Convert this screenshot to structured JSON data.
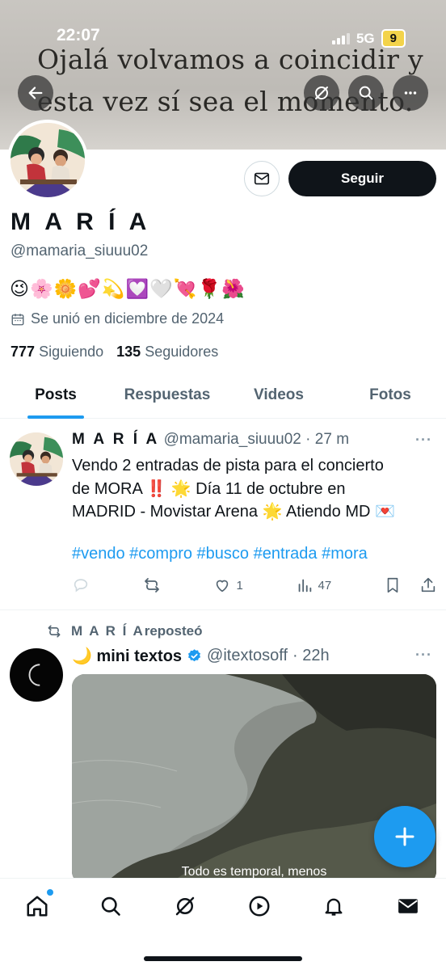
{
  "status_bar": {
    "time": "22:07",
    "network": "5G",
    "battery": "9"
  },
  "banner": {
    "line1": "Ojalá volvamos a coincidir y",
    "line2": "esta vez sí sea el momento."
  },
  "profile": {
    "name": "M A R Í A",
    "handle": "@mamaria_siuuu02",
    "bio": "😉🌸🌼💕💫💟🤍💘🌹🌺",
    "joined": "Se unió en diciembre de 2024",
    "following_count": "777",
    "following_label": "Siguiendo",
    "followers_count": "135",
    "followers_label": "Seguidores",
    "follow_button": "Seguir"
  },
  "tabs": [
    {
      "label": "Posts",
      "active": true
    },
    {
      "label": "Respuestas",
      "active": false
    },
    {
      "label": "Videos",
      "active": false
    },
    {
      "label": "Fotos",
      "active": false
    }
  ],
  "post1": {
    "author": "M A R Í A",
    "handle": "@mamaria_siuuu02",
    "time": "· 27 m",
    "line1": "Vendo 2 entradas de pista para el concierto",
    "line2": "de MORA ‼️ 🌟 Día 11 de octubre en",
    "line3": "MADRID - Movistar Arena 🌟 Atiendo MD 💌",
    "hashtags": "#vendo #compro #busco #entrada #mora",
    "likes": "1",
    "views": "47"
  },
  "post2": {
    "repost_author": "M A R Í A",
    "repost_label": "reposteó",
    "author": "🌙 mini textos",
    "handle": "@itextosoff",
    "time": "· 22h",
    "media_caption": "Todo es temporal, menos"
  },
  "icons": {
    "back": "arrow-left-icon",
    "grok": "grok-icon",
    "search": "search-icon",
    "more": "more-icon",
    "message": "mail-icon",
    "calendar": "calendar-icon",
    "reply": "reply-icon",
    "repost": "repost-icon",
    "like": "heart-icon",
    "views": "views-icon",
    "bookmark": "bookmark-icon",
    "share": "share-icon",
    "compose": "plus-icon",
    "nav": [
      "home-icon",
      "search-icon",
      "grok-icon",
      "video-icon",
      "bell-icon",
      "mail-icon"
    ]
  },
  "colors": {
    "accent": "#1d9bf0",
    "text": "#0f1419",
    "muted": "#536471",
    "follow_bg": "#0f1419"
  }
}
